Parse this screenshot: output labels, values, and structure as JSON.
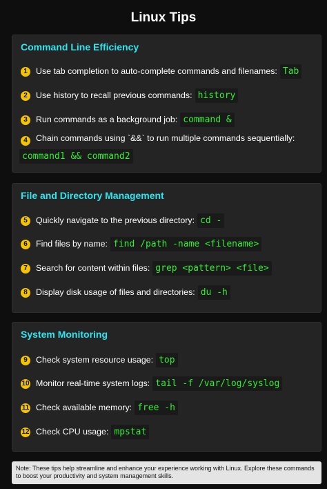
{
  "title": "Linux Tips",
  "accent_color": "#2ee6f0",
  "code_color": "#33ee33",
  "badge_color": "#f5c400",
  "sections": [
    {
      "title": "Command Line Efficiency",
      "tips": [
        {
          "num": "1",
          "text": "Use tab completion to auto-complete commands and filenames:",
          "code": "Tab"
        },
        {
          "num": "2",
          "text": "Use history to recall previous commands:",
          "code": "history"
        },
        {
          "num": "3",
          "text": "Run commands as a background job:",
          "code": "command &"
        },
        {
          "num": "4",
          "text": "Chain commands using `&&` to run multiple commands sequentially:",
          "code": "command1 && command2"
        }
      ]
    },
    {
      "title": "File and Directory Management",
      "tips": [
        {
          "num": "5",
          "text": "Quickly navigate to the previous directory:",
          "code": "cd -"
        },
        {
          "num": "6",
          "text": "Find files by name:",
          "code": "find /path -name <filename>"
        },
        {
          "num": "7",
          "text": "Search for content within files:",
          "code": "grep <pattern> <file>"
        },
        {
          "num": "8",
          "text": "Display disk usage of files and directories:",
          "code": "du -h"
        }
      ]
    },
    {
      "title": "System Monitoring",
      "tips": [
        {
          "num": "9",
          "text": "Check system resource usage:",
          "code": "top"
        },
        {
          "num": "10",
          "text": "Monitor real-time system logs:",
          "code": "tail -f /var/log/syslog"
        },
        {
          "num": "11",
          "text": "Check available memory:",
          "code": "free -h"
        },
        {
          "num": "12",
          "text": "Check CPU usage:",
          "code": "mpstat"
        }
      ]
    }
  ],
  "note": "Note: These tips help streamline and enhance your experience working with Linux. Explore these commands to boost your productivity and system management skills."
}
